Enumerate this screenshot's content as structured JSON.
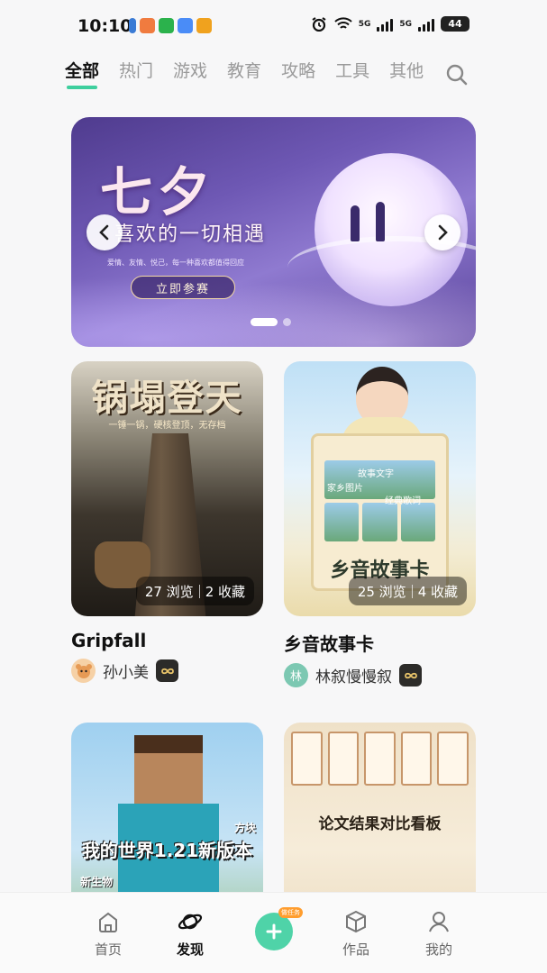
{
  "status_bar": {
    "time": "10:10",
    "network_1": "5G",
    "network_2": "5G",
    "battery": "44"
  },
  "tabs": [
    {
      "label": "全部",
      "active": true
    },
    {
      "label": "热门"
    },
    {
      "label": "游戏"
    },
    {
      "label": "教育"
    },
    {
      "label": "攻略"
    },
    {
      "label": "工具"
    },
    {
      "label": "其他"
    }
  ],
  "banner": {
    "title": "七夕",
    "subtitle": "喜欢的一切相遇",
    "small_text": "爱情、友情、悦己，每一种喜欢都值得回应",
    "button": "立即参赛"
  },
  "cards": [
    {
      "title": "Gripfall",
      "image_title": "锅塌登天",
      "image_subtitle": "一锤一锅，硬核登顶，无存档",
      "views": "27 浏览",
      "favorites": "2 收藏",
      "author": "孙小美"
    },
    {
      "title": "乡音故事卡",
      "image_title": "乡音故事卡",
      "image_labels": [
        "故事文字",
        "家乡图片",
        "经典歌词"
      ],
      "views": "25 浏览",
      "favorites": "4 收藏",
      "author": "林叙慢慢叙",
      "author_initial": "林"
    },
    {
      "image_title": "我的世界1.21新版本",
      "image_tag_right": "方块",
      "image_tag_left": "新生物"
    },
    {
      "image_title": "论文结果对比看板"
    }
  ],
  "bottom_nav": {
    "home": "首页",
    "discover": "发现",
    "create_tag": "做任务",
    "works": "作品",
    "mine": "我的"
  },
  "colors": {
    "accent": "#3ecf9e",
    "plus_button": "#4fd3a8"
  }
}
